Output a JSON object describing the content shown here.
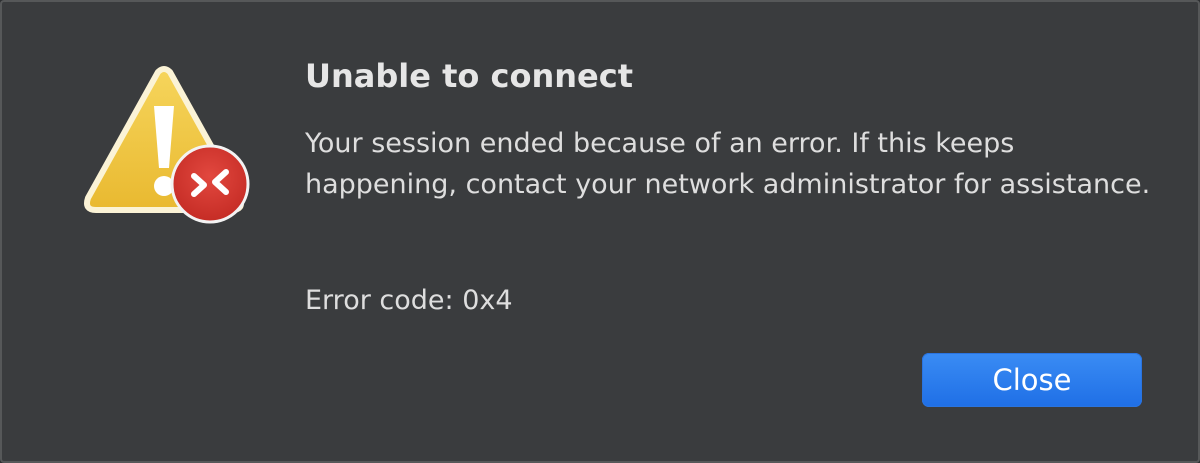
{
  "dialog": {
    "title": "Unable to connect",
    "message": "Your session ended because of an error. If this keeps happening, contact your network administrator for assistance.",
    "error_code": "Error code: 0x4",
    "close_label": "Close",
    "icon": "warning-triangle-icon",
    "badge_icon": "remote-desktop-badge-icon"
  },
  "colors": {
    "background": "#3a3c3e",
    "accent": "#2a7af0",
    "warning": "#f2c94c",
    "badge": "#d7372f"
  }
}
